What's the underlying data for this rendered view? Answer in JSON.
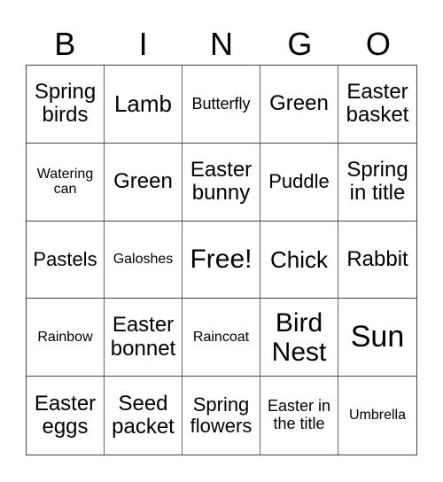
{
  "header": [
    "B",
    "I",
    "N",
    "G",
    "O"
  ],
  "cells": [
    [
      "Spring birds",
      "Lamb",
      "Butterfly",
      "Green",
      "Easter basket"
    ],
    [
      "Watering can",
      "Green",
      "Easter bunny",
      "Puddle",
      "Spring in title"
    ],
    [
      "Pastels",
      "Galoshes",
      "Free!",
      "Chick",
      "Rabbit"
    ],
    [
      "Rainbow",
      "Easter bonnet",
      "Raincoat",
      "Bird Nest",
      "Sun"
    ],
    [
      "Easter eggs",
      "Seed packet",
      "Spring flowers",
      "Easter in the title",
      "Umbrella"
    ]
  ]
}
